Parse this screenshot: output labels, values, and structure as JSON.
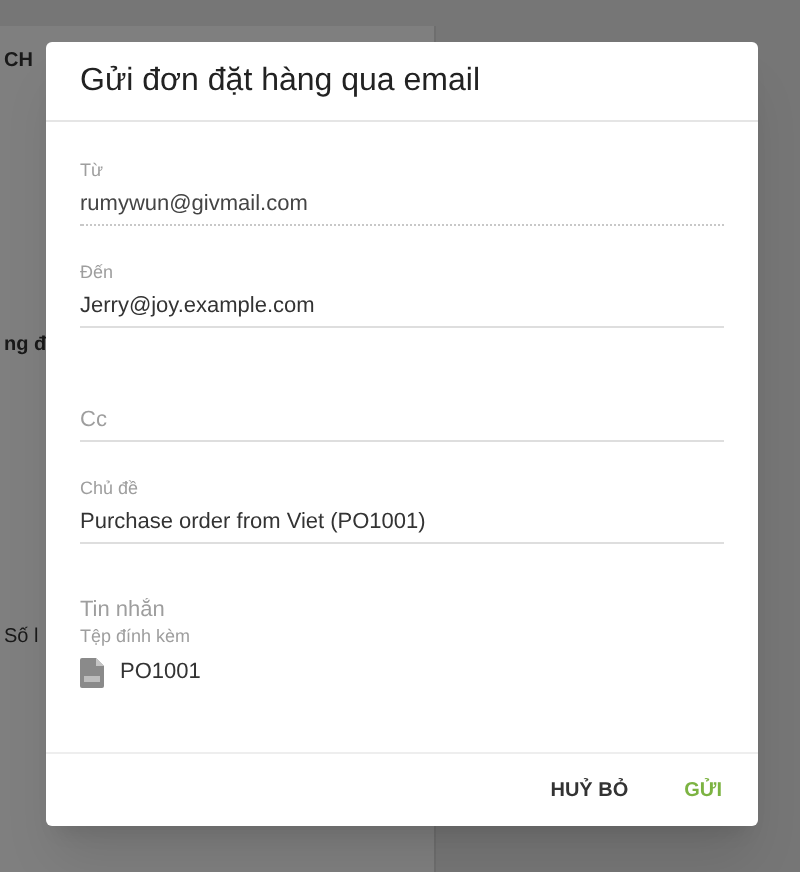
{
  "background_page": {
    "fragments": [
      {
        "text": "CH",
        "bold": true
      },
      {
        "text": "ng đ",
        "bold": true
      },
      {
        "text": "Số l",
        "bold": false
      }
    ]
  },
  "dialog": {
    "title": "Gửi đơn đặt hàng qua email",
    "fields": [
      {
        "label": "Từ",
        "value": "rumywun@givmail.com",
        "disabled": true
      },
      {
        "label": "Đến",
        "value": "Jerry@joy.example.com",
        "disabled": false
      },
      {
        "placeholder": "Cc",
        "disabled": false
      },
      {
        "label": "Chủ đề",
        "value": "Purchase order from Viet (PO1001)",
        "disabled": false
      }
    ],
    "message": {
      "placeholder": "Tin nhắn"
    },
    "attachments": {
      "label": "Tệp đính kèm",
      "files": [
        "PO1001"
      ]
    },
    "buttons": [
      {
        "label": "HUỶ BỎ",
        "kind": "secondary"
      },
      {
        "label": "GỬI",
        "kind": "primary"
      }
    ]
  }
}
